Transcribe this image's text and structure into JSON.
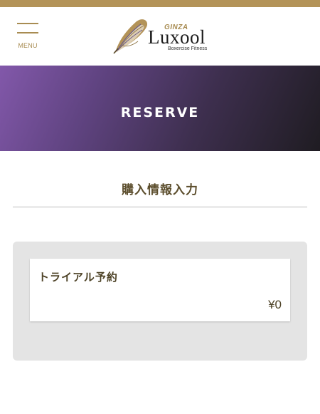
{
  "header": {
    "menu_label": "MENU",
    "logo": {
      "ginza": "GINZA",
      "name": "Luxool",
      "tagline": "Boxercise Fitness"
    }
  },
  "hero": {
    "title": "RESERVE"
  },
  "section": {
    "title": "購入情報入力"
  },
  "order": {
    "item_name": "トライアル予約",
    "price": "¥0"
  },
  "colors": {
    "accent_gold": "#b39358",
    "text_brown": "#5c4e2d",
    "hero_purple": "#8258aa",
    "hero_dark": "#1f1c22",
    "panel_gray": "#e4e4e4"
  }
}
